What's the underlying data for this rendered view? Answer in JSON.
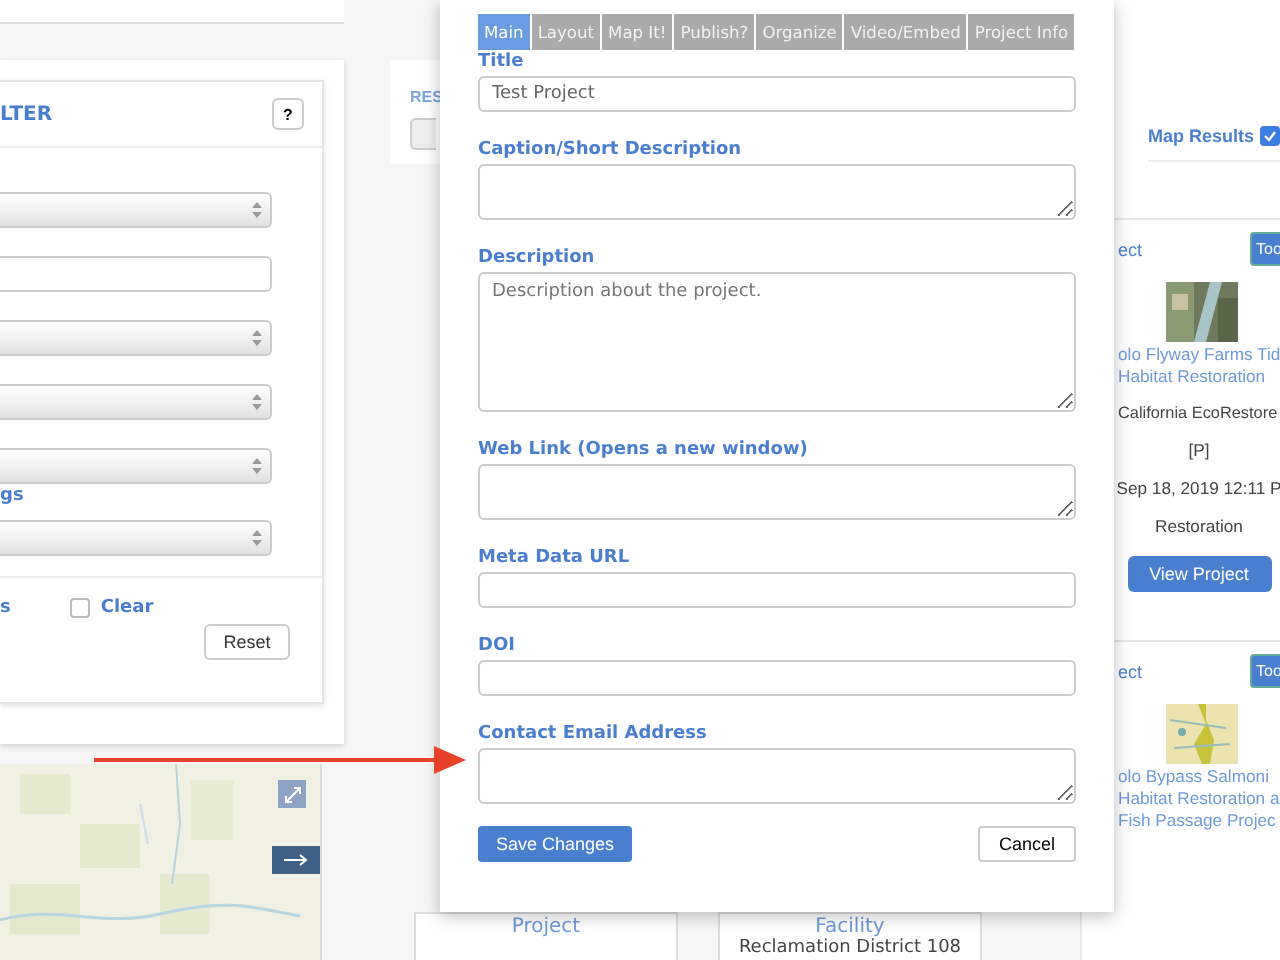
{
  "filter_panel": {
    "title": "LTER",
    "help_button": "?",
    "selects": [
      {
        "kind": "select"
      },
      {
        "kind": "text"
      },
      {
        "kind": "select"
      },
      {
        "kind": "select"
      },
      {
        "kind": "select"
      }
    ],
    "link": "gs",
    "partial_label": "s",
    "clear": {
      "label": "Clear",
      "checked": false
    },
    "reset_button": "Reset"
  },
  "results": {
    "heading": "RES",
    "map_results": {
      "label": "Map Results",
      "checked": true
    },
    "cards": [
      {
        "type_link": "ect",
        "tool_button": "Too",
        "title_lines": [
          "olo Flyway Farms Tid",
          "Habitat Restoration"
        ],
        "org": "California EcoRestore",
        "tag": "[P]",
        "date": "Sep 18, 2019 12:11 P",
        "category": "Restoration",
        "view_button": "View Project"
      },
      {
        "type_link": "ect",
        "tool_button": "Too",
        "title_lines": [
          "olo Bypass Salmoni",
          "Habitat Restoration a",
          "Fish Passage Projec"
        ]
      }
    ]
  },
  "bottom_cards": [
    {
      "title": "Project"
    },
    {
      "title": "Facility",
      "org": "Reclamation District 108"
    }
  ],
  "modal": {
    "tabs": [
      {
        "label": "Main",
        "selected": true
      },
      {
        "label": "Layout",
        "selected": false
      },
      {
        "label": "Map It!",
        "selected": false
      },
      {
        "label": "Publish?",
        "selected": false
      },
      {
        "label": "Organize",
        "selected": false
      },
      {
        "label": "Video/Embed",
        "selected": false
      },
      {
        "label": "Project Info",
        "selected": false
      }
    ],
    "fields": [
      {
        "label": "Title",
        "kind": "input",
        "value": "Test Project"
      },
      {
        "label": "Caption/Short Description",
        "kind": "textarea"
      },
      {
        "label": "Description",
        "kind": "large_textarea",
        "placeholder": "Description about the project."
      },
      {
        "label": "Web Link (Opens a new window)",
        "kind": "textarea"
      },
      {
        "label": "Meta Data URL",
        "kind": "input"
      },
      {
        "label": "DOI",
        "kind": "input"
      },
      {
        "label": "Contact Email Address",
        "kind": "textarea"
      }
    ],
    "save_button": "Save Changes",
    "cancel_button": "Cancel"
  }
}
